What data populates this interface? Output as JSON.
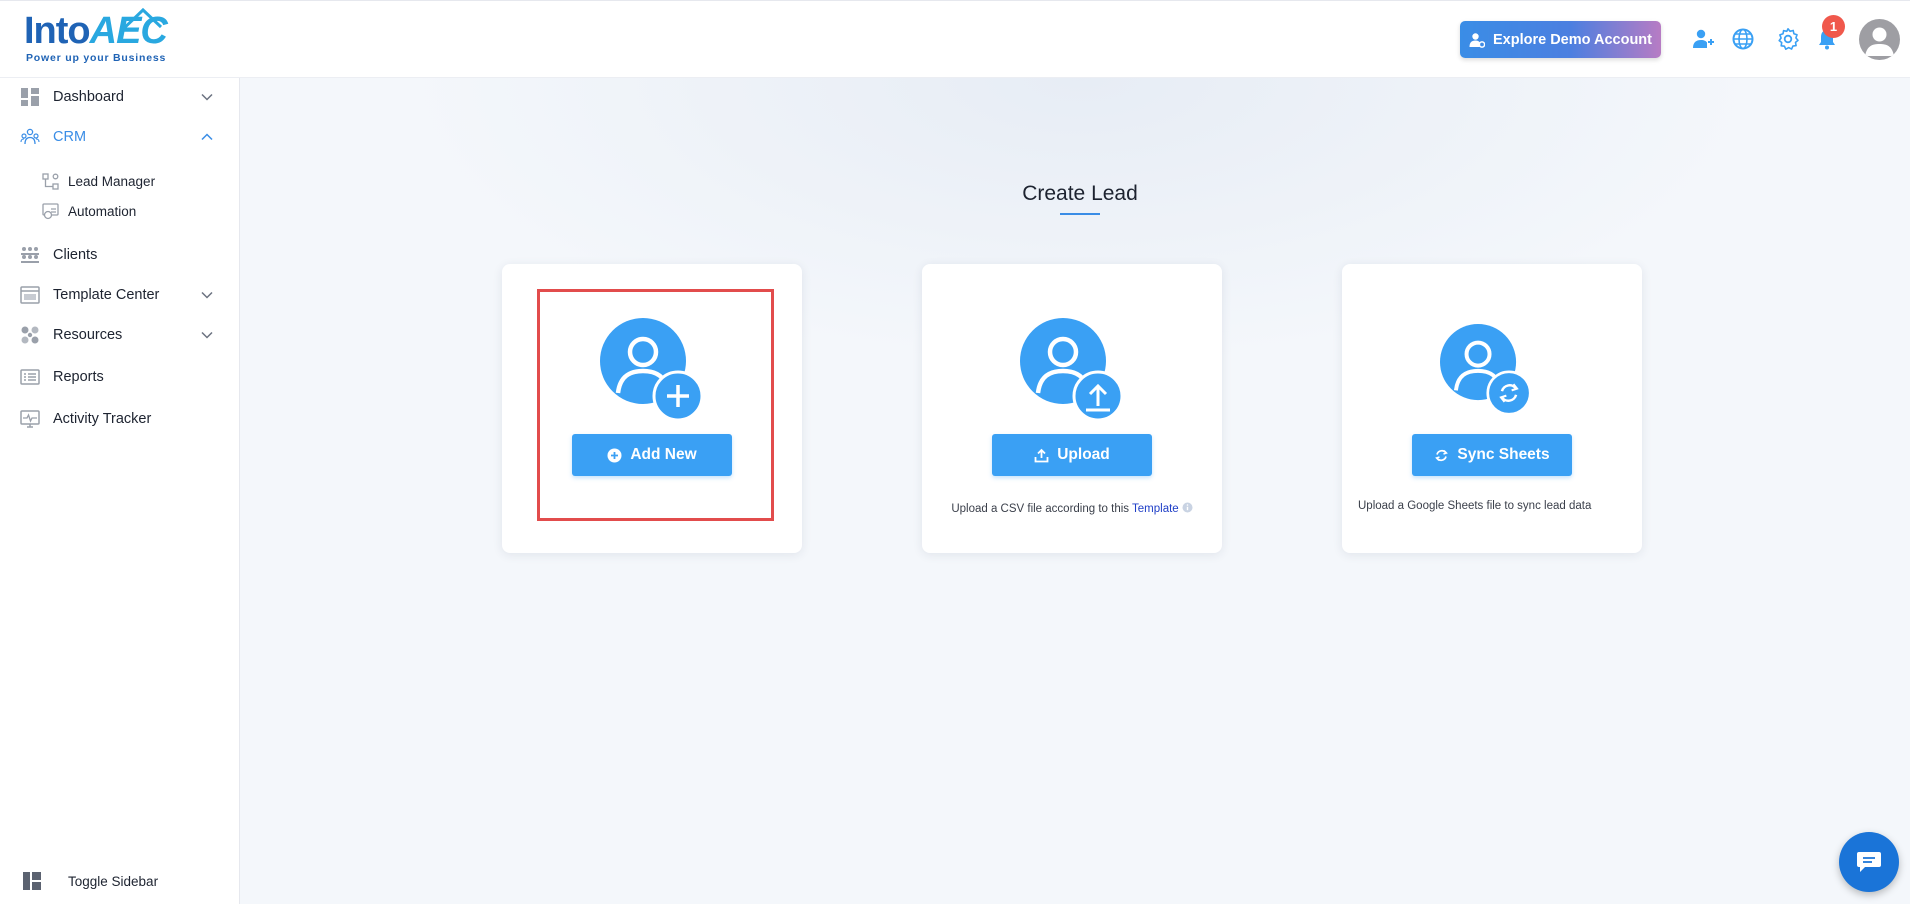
{
  "brand": {
    "name_main": "Into",
    "name_accent": "AEC",
    "tagline": "Power up your Business"
  },
  "header": {
    "demo_button_label": "Explore Demo Account",
    "notification_count": "1",
    "icons": [
      "add-user-icon",
      "globe-icon",
      "gear-icon",
      "bell-icon",
      "avatar"
    ]
  },
  "sidebar": {
    "items": [
      {
        "label": "Dashboard",
        "icon": "dashboard-icon",
        "expandable": true,
        "expanded": false
      },
      {
        "label": "CRM",
        "icon": "crm-icon",
        "expandable": true,
        "expanded": true,
        "active": true
      },
      {
        "label": "Clients",
        "icon": "clients-icon"
      },
      {
        "label": "Template Center",
        "icon": "template-icon",
        "expandable": true,
        "expanded": false
      },
      {
        "label": "Resources",
        "icon": "resources-icon",
        "expandable": true,
        "expanded": false
      },
      {
        "label": "Reports",
        "icon": "reports-icon"
      },
      {
        "label": "Activity Tracker",
        "icon": "activity-icon"
      }
    ],
    "crm_subitems": [
      {
        "label": "Lead Manager",
        "icon": "lead-manager-icon"
      },
      {
        "label": "Automation",
        "icon": "automation-icon"
      }
    ],
    "toggle_label": "Toggle Sidebar"
  },
  "main": {
    "title": "Create Lead",
    "cards": [
      {
        "button_label": "Add New",
        "note": ""
      },
      {
        "button_label": "Upload",
        "note": "Upload a CSV file according to this ",
        "note_link": "Template"
      },
      {
        "button_label": "Sync Sheets",
        "note": "Upload a Google Sheets file to sync lead data"
      }
    ]
  },
  "colors": {
    "accent": "#3aa0f4",
    "brand_blue": "#1f63b5",
    "highlight": "#e24c4c",
    "badge": "#f0584c"
  }
}
